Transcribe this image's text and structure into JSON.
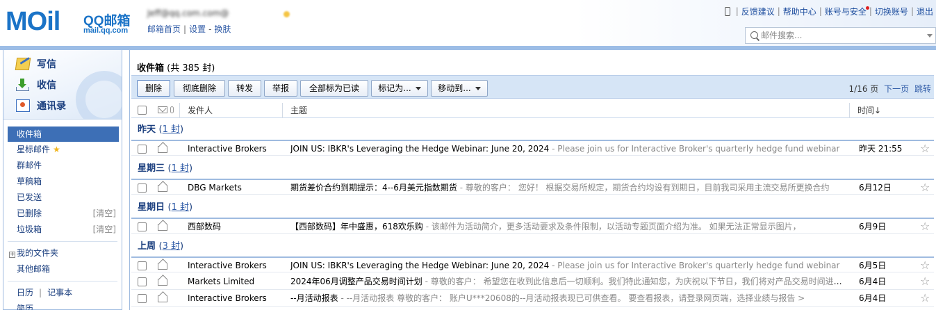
{
  "header": {
    "logo_mail": "MOil",
    "logo_qq": "QQ邮箱",
    "logo_domain": "mail.qq.com",
    "user_email": "Jeff@qq.com.com@",
    "quick_links": [
      "邮箱首页",
      "设置",
      "换肤"
    ],
    "top_nav": [
      "反馈建议",
      "帮助中心",
      "账号与安全",
      "切换账号",
      "退出"
    ],
    "search_placeholder": "邮件搜索..."
  },
  "sidebar": {
    "actions": [
      {
        "label": "写信",
        "icon": "write-icon"
      },
      {
        "label": "收信",
        "icon": "receive-icon"
      },
      {
        "label": "通讯录",
        "icon": "contacts-icon"
      }
    ],
    "folders": [
      {
        "label": "收件箱",
        "active": true
      },
      {
        "label": "星标邮件",
        "star": true
      },
      {
        "label": "群邮件"
      },
      {
        "label": "草稿箱"
      },
      {
        "label": "已发送"
      },
      {
        "label": "已删除",
        "clear": "[清空]"
      },
      {
        "label": "垃圾箱",
        "clear": "[清空]"
      }
    ],
    "my_folders": "我的文件夹",
    "other_mail": "其他邮箱",
    "calendar": "日历",
    "notes": "记事本",
    "resume": "简历"
  },
  "inbox": {
    "title": "收件箱",
    "count": "(共 385 封)"
  },
  "toolbar": {
    "buttons": [
      "删除",
      "彻底删除",
      "转发",
      "举报",
      "全部标为已读",
      "标记为...",
      "移动到..."
    ],
    "pager_current": "1/16 页",
    "pager_next": "下一页",
    "pager_jump": "跳转"
  },
  "columns": {
    "sender": "发件人",
    "subject": "主题",
    "time": "时间↓"
  },
  "groups": [
    {
      "label": "昨天",
      "count": "1 封"
    },
    {
      "label": "星期三",
      "count": "1 封"
    },
    {
      "label": "星期日",
      "count": "1 封"
    },
    {
      "label": "上周",
      "count": "3 封"
    }
  ],
  "mails": [
    {
      "sender": "Interactive Brokers",
      "subject": "JOIN US: IBKR's Leveraging the Hedge Webinar: June 20, 2024",
      "preview": " - Please join us for Interactive Broker's quarterly hedge fund webinar",
      "date": "昨天 21:55"
    },
    {
      "sender": "DBG Markets",
      "subject": "期货差价合约到期提示：4--6月美元指数期货",
      "preview": " - 尊敬的客户：  您好！    根据交易所规定，期货合约均设有到期日，目前我司采用主流交易所更换合约",
      "date": "6月12日"
    },
    {
      "sender": "西部数码",
      "subject": "【西部数码】年中盛惠，618欢乐购",
      "preview": " - 该邮件为活动简介，更多活动要求及条件限制，以活动专题页面介绍为准。          如果无法正常显示图片，",
      "date": "6月9日"
    },
    {
      "sender": "Interactive Brokers",
      "subject": "JOIN US: IBKR's Leveraging the Hedge Webinar: June 20, 2024",
      "preview": " - Please join us for Interactive Broker's quarterly hedge fund webinar",
      "date": "6月5日"
    },
    {
      "sender": "Markets Limited",
      "subject": "2024年06月调整产品交易时间计划",
      "preview": " - 尊敬的客户：  希望您在收到此信息后一切顺利。我们特此通知您，为庆祝以下节日，我们将对产品交易时间进行调整",
      "date": "6月4日"
    },
    {
      "sender": "Interactive Brokers",
      "subject": "--月活动报表",
      "preview": " - --月活动报表    尊敬的客户：   账户U***20608的--月活动报表现已可供查看。    要查看报表，请登录网页端，选择业绩与报告 >",
      "date": "6月4日"
    }
  ]
}
